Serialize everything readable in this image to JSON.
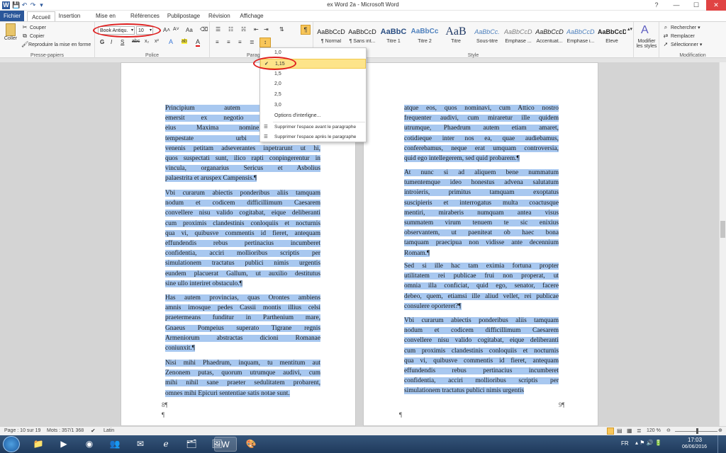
{
  "window": {
    "title": "ex Word 2a - Microsoft Word",
    "controls": [
      "?",
      "—",
      "☐",
      "✕"
    ]
  },
  "quick_access": [
    "W",
    "💾",
    "↶",
    "↷",
    "▾"
  ],
  "tabs": [
    "Fichier",
    "Accueil",
    "Insertion",
    "Mise en page",
    "Références",
    "Publipostage",
    "Révision",
    "Affichage"
  ],
  "clipboard": {
    "paste": "Coller",
    "cut": "Couper",
    "copy": "Copier",
    "format_painter": "Reproduire la mise en forme",
    "label": "Presse-papiers"
  },
  "font": {
    "name": "Book Antiqu.",
    "size": "10",
    "label": "Police",
    "grow": "A˄",
    "shrink": "A˅",
    "case": "Aa",
    "bold": "G",
    "italic": "I",
    "underline": "S",
    "strike": "abc",
    "sub": "x₂",
    "sup": "x²",
    "effects": "A",
    "highlight": "ab",
    "color": "A"
  },
  "paragraph": {
    "label": "Paragr",
    "pilcrow": "¶"
  },
  "styles": {
    "label": "Style",
    "items": [
      {
        "preview": "AaBbCcD",
        "name": "¶ Normal"
      },
      {
        "preview": "AaBbCcD",
        "name": "¶ Sans int..."
      },
      {
        "preview": "AaBbC",
        "name": "Titre 1"
      },
      {
        "preview": "AaBbCc",
        "name": "Titre 2"
      },
      {
        "preview": "AaB",
        "name": "Titre"
      },
      {
        "preview": "AaBbCc.",
        "name": "Sous-titre"
      },
      {
        "preview": "AaBbCcDd",
        "name": "Emphase ..."
      },
      {
        "preview": "AaBbCcD",
        "name": "Accentuat..."
      },
      {
        "preview": "AaBbCcDd",
        "name": "Emphase i..."
      },
      {
        "preview": "AaBbCcD",
        "name": "Élevé"
      }
    ],
    "change": "Modifier les styles"
  },
  "editing": {
    "find": "Rechercher",
    "replace": "Remplacer",
    "select": "Sélectionner",
    "label": "Modification"
  },
  "spacing_menu": {
    "items": [
      "1,0",
      "1,15",
      "1,5",
      "2,0",
      "2,5",
      "3,0"
    ],
    "selected": "1,15",
    "check": "✓",
    "options": "Options d'interligne...",
    "before": "Supprimer l'espace avant le paragraphe",
    "after": "Supprimer l'espace après le paragraphe"
  },
  "page_left": {
    "paras": [
      {
        "lines": [
          "Principium autem unde lati",
          "emersit ex negotio tali. Chilo v",
          "eius Maxima nomine, questi c",
          "tempestate urbi praefectum,",
          "venenis petitam adseverantes inpetrarunt ut hi,",
          "quos suspectati sunt, ilico rapti conpingerentur in",
          "vincula, organarius Sericus et Asbolius",
          "palaestrita et aruspex Campensis.¶"
        ]
      },
      {
        "lines": [
          "Vbi curarum abiectis ponderibus aliis tamquam",
          "nodum et codicem difficillimum Caesarem",
          "convellere nisu valido cogitabat, eique deliberanti",
          "cum proximis clandestinis conloquiis et nocturnis",
          "qua vi, quibusve commentis id fieret, antequam",
          "effundendis rebus pertinacius incumberet",
          "confidentia, acciri mollioribus scriptis per",
          "simulationem tractatus publici nimis urgentis",
          "eundem placuerat Gallum, ut auxilio destitutus",
          "sine ullo interiret obstaculo.¶"
        ]
      },
      {
        "lines": [
          "Has autem provincias, quas Orontes ambiens",
          "amnis imosque pedes Cassii montis illius celsi",
          "praetermeans funditur in Parthenium mare,",
          "Gnaeus Pompeius superato Tigrane regnis",
          "Armeniorum abstractas dicioni Romanae",
          "coniunxit.¶"
        ]
      },
      {
        "lines": [
          "Nisi mihi Phaedrum, inquam, tu mentitum aut",
          "Zenonem putas, quorum utrumque audivi, cum",
          "mihi nihil sane praeter sedulitatem probarent,",
          "omnes mihi Epicuri sententiae satis notae sunt."
        ]
      }
    ],
    "footer": "8¶",
    "after": "¶"
  },
  "page_right": {
    "paras": [
      {
        "lines": [
          "atque eos, quos nominavi, cum Attico nostro",
          "frequenter audivi, cum miraretur ille quidem",
          "utrumque, Phaedrum autem etiam amaret,",
          "cotidieque inter nos ea, quae audiebamus,",
          "conferebamus, neque erat umquam controversia,",
          "quid ego intellegerem, sed quid probarem.¶"
        ]
      },
      {
        "lines": [
          "At nunc si ad aliquem bene nummatum",
          "tumentemque ideo honestus advena salutatum",
          "introieris, primitus tamquam exoptatus",
          "suscipieris et interrogatus multa coactusque",
          "mentiri, miraberis numquam antea visus",
          "summatem virum tenuem te sic enixius",
          "observantem, ut paeniteat ob haec bona",
          "tamquam praecipua non vidisse ante decennium",
          "Romam.¶"
        ]
      },
      {
        "lines": [
          "Sed si ille hac tam eximia fortuna propter",
          "utilitatem rei publicae frui non properat, ut",
          "omnia illa conficiat, quid ego, senator, facere",
          "debeo, quem, etiamsi ille aliud vellet, rei publicae",
          "consulere oporteret?¶"
        ]
      },
      {
        "lines": [
          "Vbi curarum abiectis ponderibus aliis tamquam",
          "nodum et codicem difficillimum Caesarem",
          "convellere nisu valido cogitabat, eique deliberanti",
          "cum proximis clandestinis conloquiis et nocturnis",
          "qua vi, quibusve commentis id fieret, antequam",
          "effundendis rebus pertinacius incumberet",
          "confidentia, acciri mollioribus scriptis per",
          "simulationem tractatus publici nimis urgentis"
        ]
      }
    ],
    "footer": "9¶",
    "after": "¶"
  },
  "status": {
    "page": "Page : 10 sur 19",
    "words": "Mots : 357/1 368",
    "lang": "Latin",
    "zoom": "120 %"
  },
  "taskbar": {
    "lang": "FR",
    "time": "17:03",
    "date": "06/06/2016"
  }
}
